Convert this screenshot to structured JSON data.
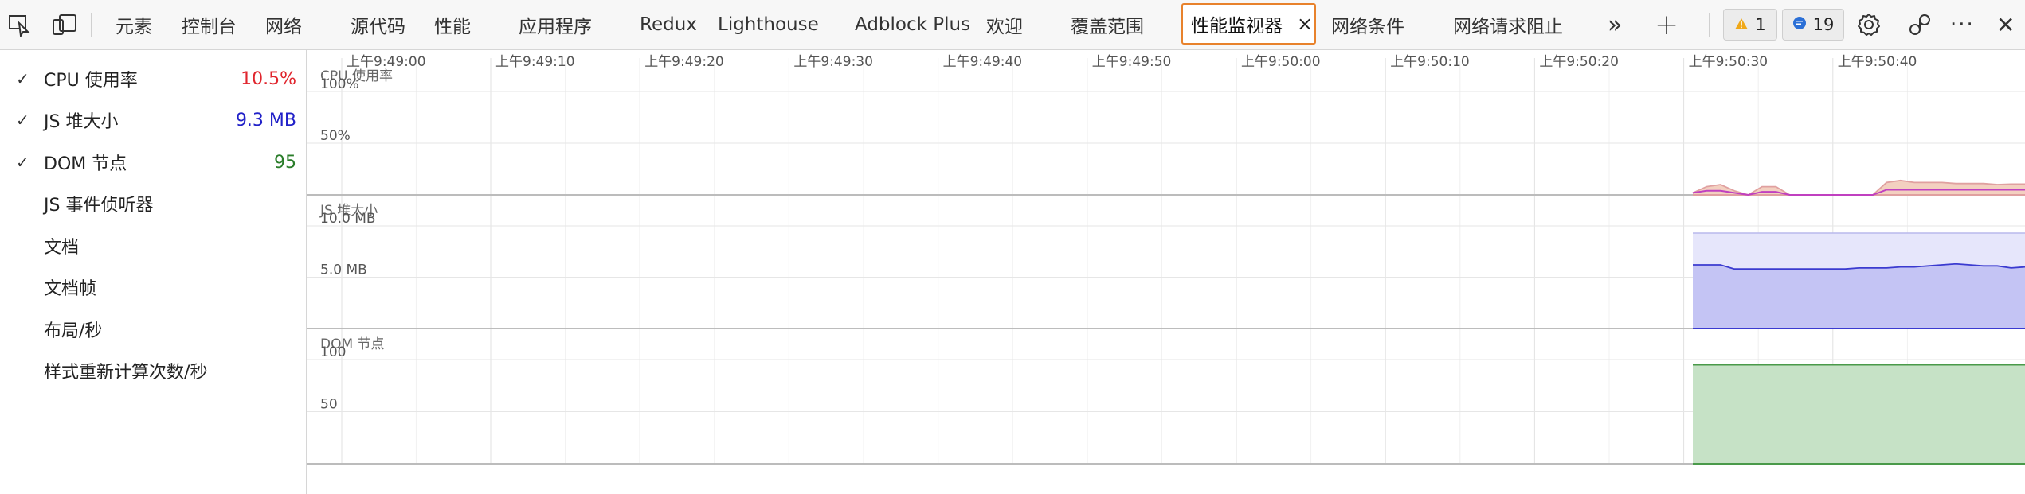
{
  "toolbar": {
    "inspect_icon": "inspect-element-icon",
    "device_icon": "device-toolbar-icon",
    "tabs": [
      {
        "label": "元素"
      },
      {
        "label": "控制台"
      },
      {
        "label": "网络"
      },
      {
        "label": "源代码"
      },
      {
        "label": "性能"
      },
      {
        "label": "应用程序"
      },
      {
        "label": "Redux"
      },
      {
        "label": "Lighthouse"
      },
      {
        "label": "Adblock Plus"
      },
      {
        "label": "欢迎"
      },
      {
        "label": "覆盖范围"
      },
      {
        "label": "性能监视器",
        "active": true
      },
      {
        "label": "网络条件"
      },
      {
        "label": "网络请求阻止"
      }
    ],
    "close_glyph": "×",
    "more_tabs_glyph": "»",
    "add_glyph": "+",
    "warnings_count": "1",
    "messages_count": "19",
    "more_glyph": "···",
    "close_devtools_glyph": "✕"
  },
  "metrics": [
    {
      "label": "CPU 使用率",
      "value": "10.5%",
      "checked": true,
      "color": "#e0252d"
    },
    {
      "label": "JS 堆大小",
      "value": "9.3 MB",
      "checked": true,
      "color": "#2020c8"
    },
    {
      "label": "DOM 节点",
      "value": "95",
      "checked": true,
      "color": "#2a7d2a"
    },
    {
      "label": "JS 事件侦听器",
      "value": "",
      "checked": false
    },
    {
      "label": "文档",
      "value": "",
      "checked": false
    },
    {
      "label": "文档帧",
      "value": "",
      "checked": false
    },
    {
      "label": "布局/秒",
      "value": "",
      "checked": false
    },
    {
      "label": "样式重新计算次数/秒",
      "value": "",
      "checked": false
    }
  ],
  "check_glyph": "✓",
  "chart_data": {
    "type": "area",
    "time_ticks": [
      "上午9:49:00",
      "上午9:49:10",
      "上午9:49:20",
      "上午9:49:30",
      "上午9:49:40",
      "上午9:49:50",
      "上午9:50:00",
      "上午9:50:10",
      "上午9:50:20",
      "上午9:50:30",
      "上午9:50:40"
    ],
    "panels": [
      {
        "title": "CPU 使用率",
        "ticks": [
          {
            "label": "100%",
            "v": 100
          },
          {
            "label": "50%",
            "v": 50
          }
        ],
        "ymax": 100,
        "color": "#e0a0a0",
        "fill": "#f3d0c0",
        "series": [
          {
            "name": "CPU 使用率",
            "t": [
              0,
              1,
              2,
              3,
              4,
              5,
              6,
              7,
              8,
              9,
              10,
              11,
              12,
              13,
              14,
              15,
              16,
              17,
              18,
              19,
              20,
              21,
              22,
              23,
              24
            ],
            "v": [
              2,
              8,
              10,
              4,
              0,
              8,
              8,
              0,
              0,
              0,
              0,
              0,
              0,
              0,
              12,
              14,
              12,
              12,
              12,
              11,
              11,
              11,
              10,
              10.5,
              10.5
            ]
          }
        ],
        "overlay_color": "#c040c0",
        "overlay": [
          2,
          4,
          4,
          2,
          0,
          3,
          3,
          0,
          0,
          0,
          0,
          0,
          0,
          0,
          5,
          5,
          5,
          5,
          5,
          5,
          5,
          5,
          5,
          5,
          5
        ]
      },
      {
        "title": "JS 堆大小",
        "ticks": [
          {
            "label": "10.0 MB",
            "v": 10
          },
          {
            "label": "5.0 MB",
            "v": 5
          }
        ],
        "ymax": 10,
        "ybase_top": 9.3,
        "color": "#3b3bd0",
        "fill": "#c4c4f4",
        "upper_fill": "#e6e6fb",
        "series": [
          {
            "name": "JS 堆大小",
            "t": [
              0,
              1,
              2,
              3,
              4,
              5,
              6,
              7,
              8,
              9,
              10,
              11,
              12,
              13,
              14,
              15,
              16,
              17,
              18,
              19,
              20,
              21,
              22,
              23,
              24
            ],
            "v": [
              6.2,
              6.2,
              6.2,
              5.8,
              5.8,
              5.8,
              5.8,
              5.8,
              5.8,
              5.8,
              5.8,
              5.8,
              5.9,
              5.9,
              5.9,
              6.0,
              6.0,
              6.1,
              6.2,
              6.3,
              6.2,
              6.1,
              6.1,
              5.9,
              6.0
            ]
          }
        ]
      },
      {
        "title": "DOM 节点",
        "ticks": [
          {
            "label": "100",
            "v": 100
          },
          {
            "label": "50",
            "v": 50
          }
        ],
        "ymax": 100,
        "color": "#4a9a4a",
        "fill": "#c6e2c6",
        "series": [
          {
            "name": "DOM 节点",
            "t": [
              0,
              24
            ],
            "v": [
              95,
              95
            ]
          }
        ]
      }
    ]
  }
}
